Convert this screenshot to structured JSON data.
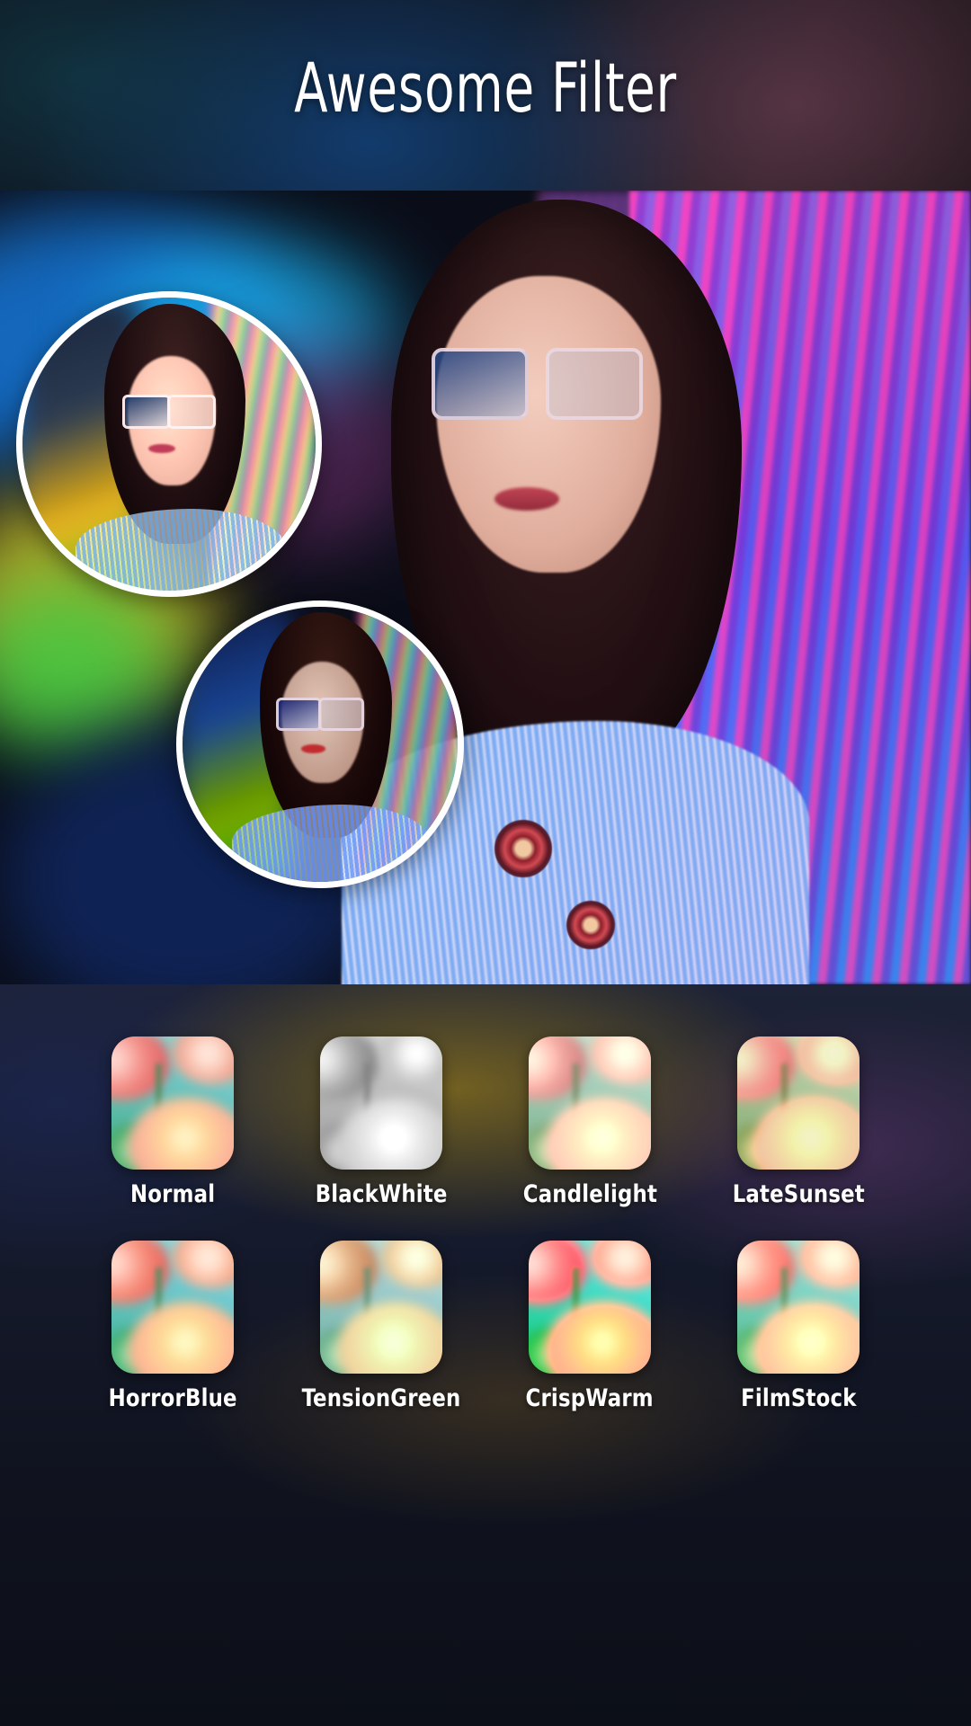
{
  "header": {
    "title": "Awesome Filter"
  },
  "main_preview": {
    "alt": "portrait-photo-neon-background",
    "circle_previews": [
      {
        "name": "circle-preview-warm",
        "style": "warm"
      },
      {
        "name": "circle-preview-cool",
        "style": "cool"
      }
    ]
  },
  "filters": {
    "items": [
      {
        "label": "Normal",
        "icon": "flower-thumbnail",
        "style": "normal"
      },
      {
        "label": "BlackWhite",
        "icon": "flower-thumbnail",
        "style": "blackwhite"
      },
      {
        "label": "Candlelight",
        "icon": "flower-thumbnail",
        "style": "candlelight"
      },
      {
        "label": "LateSunset",
        "icon": "flower-thumbnail",
        "style": "latesunset"
      },
      {
        "label": "HorrorBlue",
        "icon": "flower-thumbnail",
        "style": "horrorblue"
      },
      {
        "label": "TensionGreen",
        "icon": "flower-thumbnail",
        "style": "tensiongreen"
      },
      {
        "label": "CrispWarm",
        "icon": "flower-thumbnail",
        "style": "crispwarm"
      },
      {
        "label": "FilmStock",
        "icon": "flower-thumbnail",
        "style": "filmstock"
      }
    ]
  },
  "colors": {
    "label_text": "#ffffff",
    "title_text": "#ffffff",
    "circle_ring": "#ffffff",
    "panel_top_glow": "#ba9614",
    "panel_base": "#10131f"
  }
}
